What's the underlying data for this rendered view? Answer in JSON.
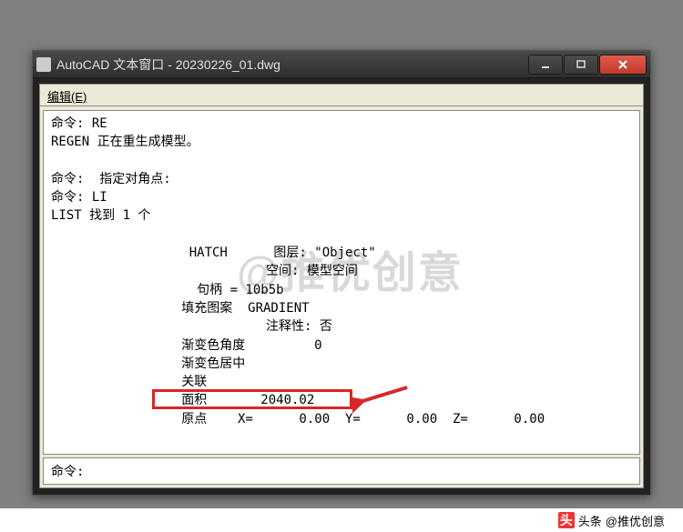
{
  "window": {
    "title": "AutoCAD 文本窗口 - 20230226_01.dwg"
  },
  "menubar": {
    "edit": "编辑(E)"
  },
  "console": {
    "lines": [
      "命令: RE",
      "REGEN 正在重生成模型。",
      "",
      "命令:  指定对角点:",
      "命令: LI",
      "LIST 找到 1 个",
      "",
      "                  HATCH      图层: \"Object\"",
      "                            空间: 模型空间",
      "                   句柄 = 10b5b",
      "                 填充图案  GRADIENT",
      "                            注释性: 否",
      "                 渐变色角度         0",
      "                 渐变色居中",
      "                 关联",
      "                 面积       2040.02",
      "                 原点    X=      0.00  Y=      0.00  Z=      0.00",
      ""
    ]
  },
  "highlight": {
    "row_index": 15,
    "value_label": "面积",
    "value": "2040.02"
  },
  "command_line": {
    "prompt": "命令:"
  },
  "watermark": "@推优创意",
  "footer": {
    "source_icon": "头",
    "source_label": "头条",
    "attribution": "@推优创意"
  }
}
